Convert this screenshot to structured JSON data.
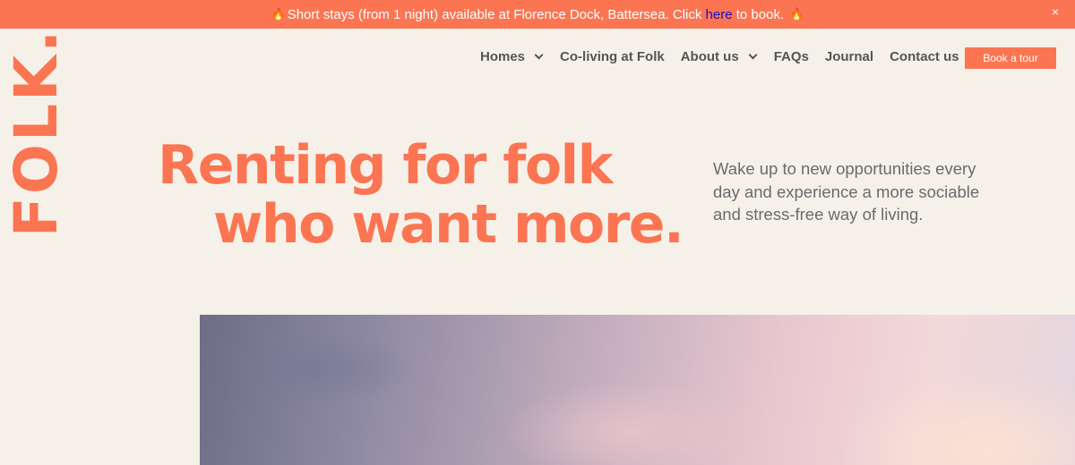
{
  "banner": {
    "flame_icon": "🔥",
    "text_before": "Short stays (from 1 night) available at Florence Dock, Battersea. Click ",
    "link_text": "here",
    "text_after": " to book.",
    "close_icon": "×"
  },
  "logo": {
    "text": "FOLK."
  },
  "nav": {
    "items": [
      {
        "label": "Homes",
        "has_dropdown": true
      },
      {
        "label": "Co-living at Folk",
        "has_dropdown": false
      },
      {
        "label": "About us",
        "has_dropdown": true
      },
      {
        "label": "FAQs",
        "has_dropdown": false
      },
      {
        "label": "Journal",
        "has_dropdown": false
      },
      {
        "label": "Contact us",
        "has_dropdown": false
      }
    ],
    "cta_label": "Book a tour"
  },
  "hero": {
    "title_line1": "Renting for folk",
    "title_line2": "who want more.",
    "tagline": "Wake up to new opportunities every day and experience a more sociable and stress-free way of living."
  },
  "colors": {
    "accent": "#fb7552",
    "background": "#f5f1e9",
    "link": "#1b0ecb",
    "text": "#555555"
  }
}
